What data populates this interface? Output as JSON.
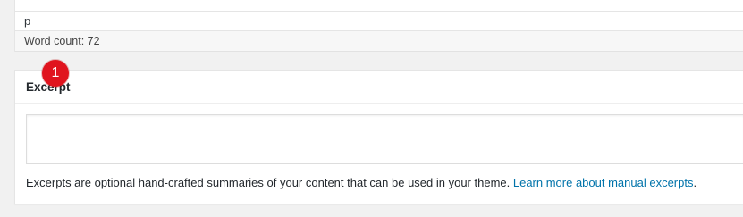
{
  "editor": {
    "path": "p",
    "word_count": "Word count: 72"
  },
  "excerpt_box": {
    "title": "Excerpt",
    "textarea_value": "",
    "step_badge": "1",
    "help_text": "Excerpts are optional hand-crafted summaries of your content that can be used in your theme. ",
    "help_link": "Learn more about manual excerpts",
    "help_suffix": "."
  },
  "colors": {
    "link": "#0073aa",
    "badge": "#e0141e",
    "background": "#f1f1f1"
  }
}
